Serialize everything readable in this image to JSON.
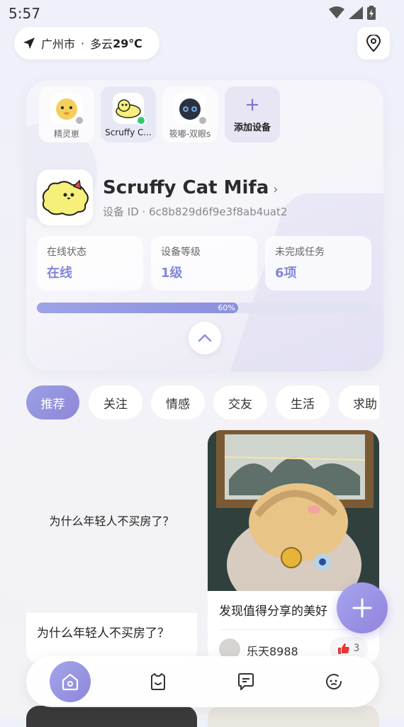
{
  "status_bar": {
    "time": "5:57"
  },
  "location": {
    "city": "广州市",
    "separator": "·",
    "weather": "多云",
    "temperature": "29℃"
  },
  "devices": [
    {
      "label": "精灵崽",
      "status_color": "#b8b8b8"
    },
    {
      "label": "Scruffy C...",
      "status_color": "#2ecc71"
    },
    {
      "label": "筱嘟-双眼s",
      "status_color": "#b8b8b8"
    }
  ],
  "add_device": {
    "plus": "+",
    "label": "添加设备"
  },
  "current_device": {
    "name": "Scruffy Cat Mifa",
    "chevron": "›",
    "id_text": "设备 ID · 6c8b829d6f9e3f8ab4uat2"
  },
  "stats": [
    {
      "label": "在线状态",
      "value": "在线"
    },
    {
      "label": "设备等级",
      "value": "1级"
    },
    {
      "label": "未完成任务",
      "value": "6项"
    }
  ],
  "progress": {
    "value": 0.6,
    "text": "60%"
  },
  "category_tabs": [
    "推荐",
    "关注",
    "情感",
    "交友",
    "生活",
    "求助"
  ],
  "active_tab": "推荐",
  "feed": {
    "left": {
      "cover_text": "为什么年轻人不买房了？",
      "title": "为什么年轻人不买房了？"
    },
    "right": {
      "title": "发现值得分享的美好",
      "author": "乐天8988",
      "likes": "3"
    }
  },
  "colors": {
    "accent": "#8b8fdf",
    "online": "#2ecc71",
    "offline": "#b8b8b8",
    "like": "#e53935"
  },
  "icons": {
    "fab": "plus-icon",
    "nav": [
      "home-icon",
      "bag-icon",
      "chat-icon",
      "face-icon"
    ]
  }
}
